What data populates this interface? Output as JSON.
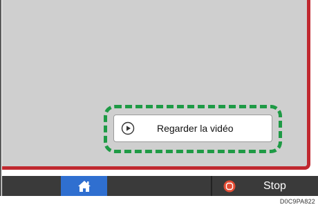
{
  "video": {
    "label": "Regarder la vidéo",
    "icon": "play-circle-icon"
  },
  "bottom_bar": {
    "home_icon": "home-icon",
    "stop_icon": "stop-icon",
    "stop_label": "Stop"
  },
  "figure_id": "D0C9PA822",
  "colors": {
    "screen_bg": "#cfcfcf",
    "screen_border": "#c0282f",
    "highlight": "#1e9a45",
    "home_button": "#2f6fd0",
    "bar": "#3a3a3a",
    "stop_icon": "#e24b33"
  }
}
